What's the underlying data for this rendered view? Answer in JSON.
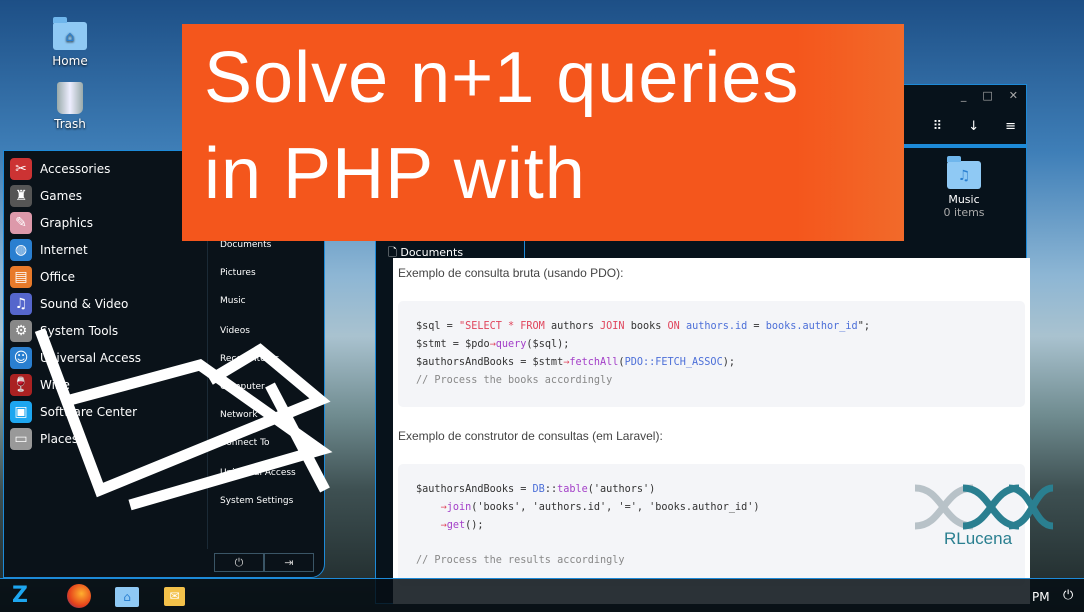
{
  "desktop": {
    "icons": [
      {
        "label": "Home",
        "icon": "home-folder-icon"
      },
      {
        "label": "Trash",
        "icon": "trash-icon"
      }
    ]
  },
  "start_menu": {
    "categories": [
      {
        "label": "Accessories",
        "icon": "accessories-icon"
      },
      {
        "label": "Games",
        "icon": "games-icon"
      },
      {
        "label": "Graphics",
        "icon": "graphics-icon"
      },
      {
        "label": "Internet",
        "icon": "internet-icon"
      },
      {
        "label": "Office",
        "icon": "office-icon"
      },
      {
        "label": "Sound & Video",
        "icon": "sound-video-icon"
      },
      {
        "label": "System Tools",
        "icon": "gear-icon"
      },
      {
        "label": "Universal Access",
        "icon": "accessibility-icon"
      },
      {
        "label": "Wine",
        "icon": "wine-icon"
      },
      {
        "label": "Software Center",
        "icon": "software-center-icon"
      },
      {
        "label": "Places",
        "icon": "places-icon"
      }
    ],
    "places": [
      "Documents",
      "Pictures",
      "Music",
      "Videos",
      "Recent Items",
      "Computer",
      "Network",
      "Connect To",
      "Universal Access",
      "System Settings"
    ],
    "power_icon": "power-icon",
    "logout_icon": "logout-icon"
  },
  "file_manager": {
    "sidebar": [
      {
        "label": "Documents"
      }
    ],
    "folders": [
      {
        "name": "Music",
        "count": "0 items"
      }
    ],
    "toolbar_icons": [
      "grid-view-icon",
      "download-icon",
      "menu-icon"
    ]
  },
  "banner": {
    "line1": "Solve n+1 queries",
    "line2": "in PHP with",
    "bg": "#f4561c"
  },
  "article": {
    "para1": "Exemplo de consulta bruta (usando PDO):",
    "para2": "Exemplo de construtor de consultas (em Laravel):",
    "code1": [
      "$sql = \"SELECT * FROM authors JOIN books ON authors.id = books.author_id\";",
      "$stmt = $pdo→query($sql);",
      "$authorsAndBooks = $stmt→fetchAll(PDO::FETCH_ASSOC);",
      "// Process the books accordingly"
    ],
    "code2": [
      "$authorsAndBooks = DB::table('authors')",
      "    →join('books', 'authors.id', '=', 'books.author_id')",
      "    →get();",
      "",
      "// Process the results accordingly"
    ]
  },
  "watermark": {
    "text": "RLucena"
  },
  "taskbar": {
    "clock": "PM",
    "apps": [
      "zorin-menu-icon",
      "firefox-icon",
      "files-icon",
      "mail-icon"
    ]
  }
}
